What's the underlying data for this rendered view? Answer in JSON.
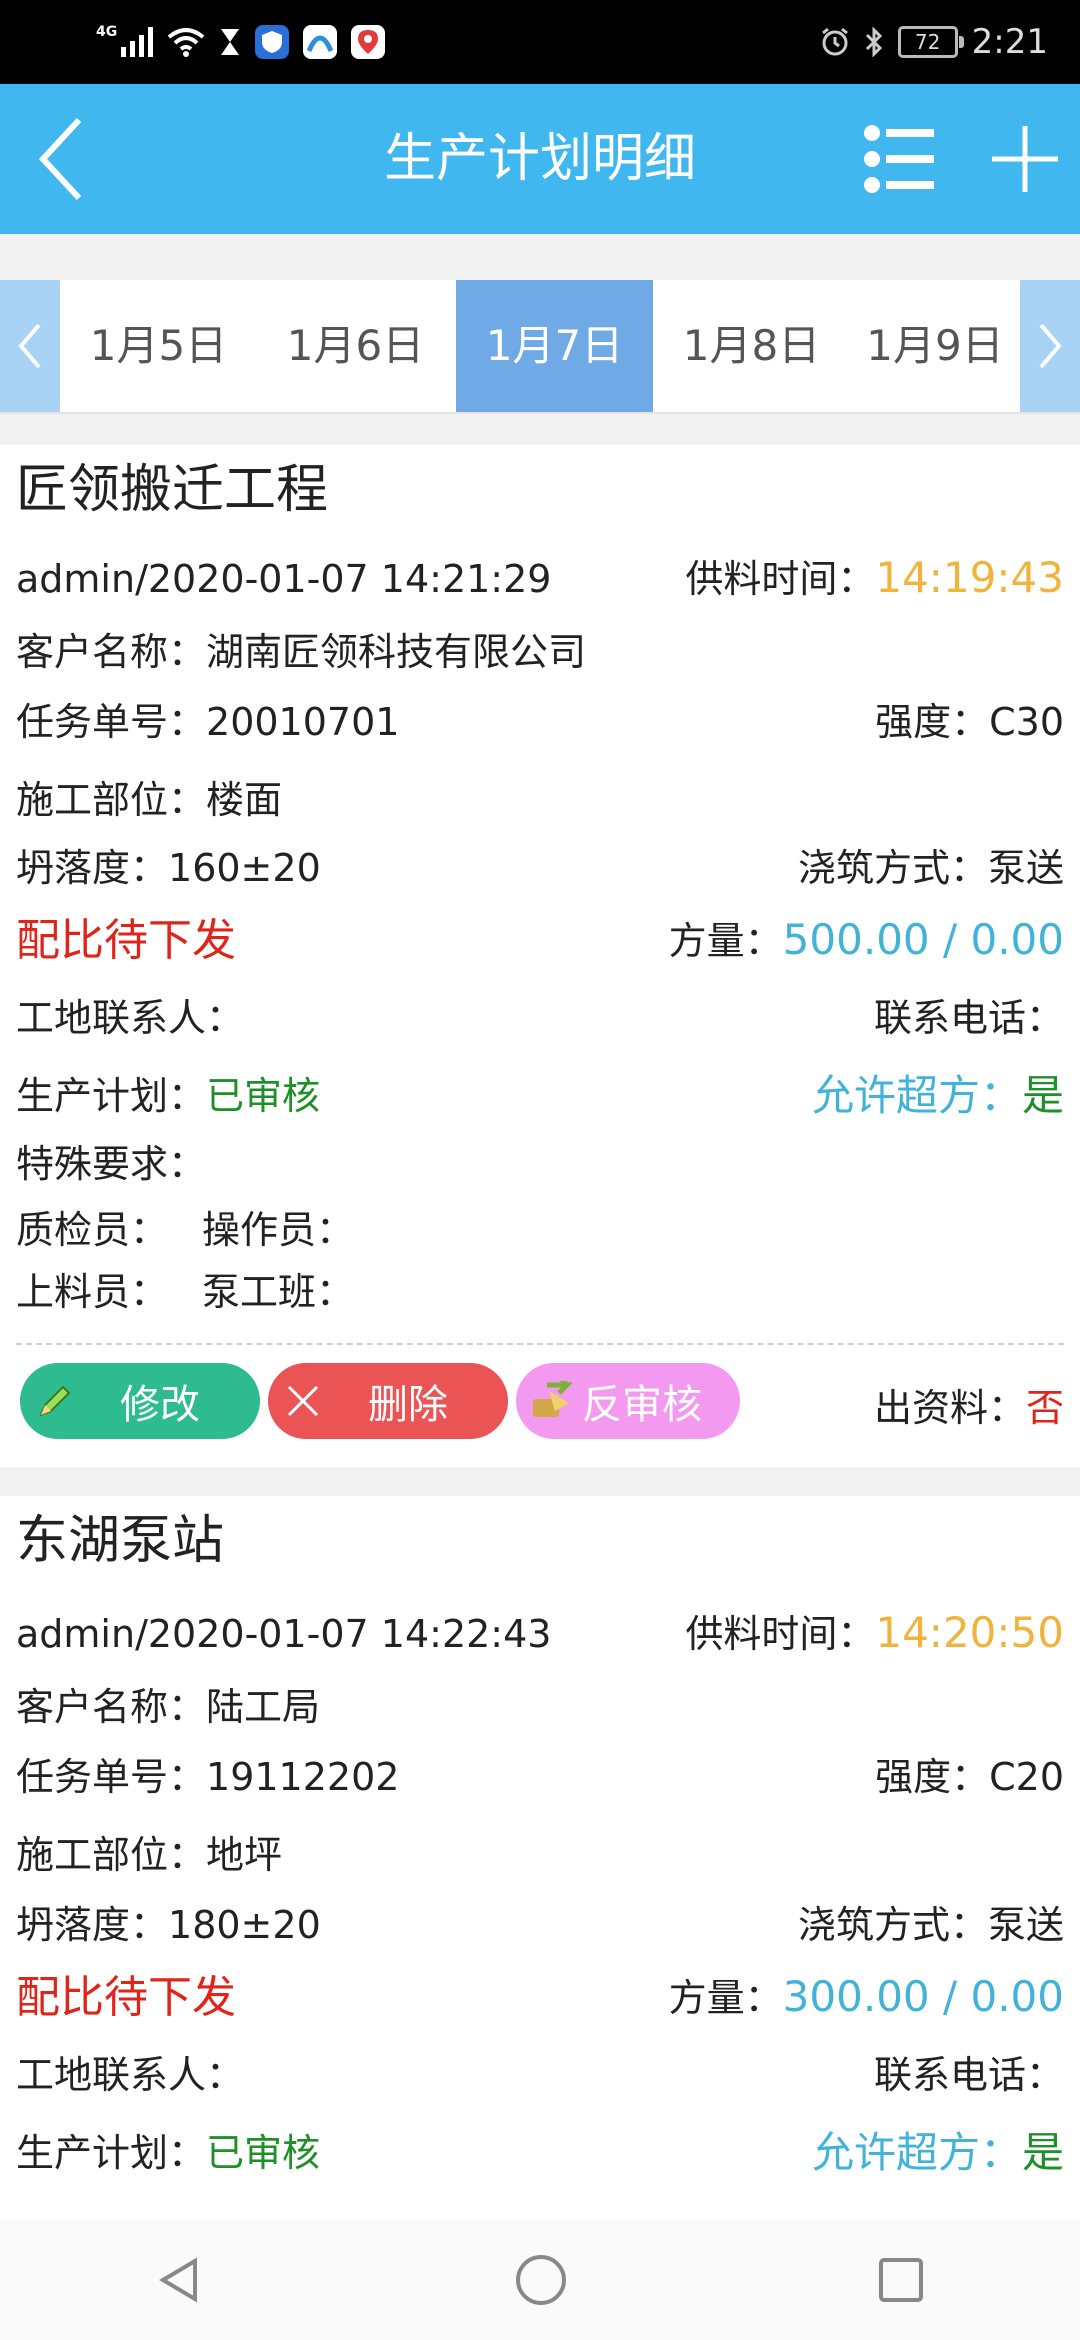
{
  "status_bar": {
    "network": "4G",
    "battery": "72",
    "time": "2:21"
  },
  "header": {
    "title": "生产计划明细"
  },
  "date_tabs": [
    "1月5日",
    "1月6日",
    "1月7日",
    "1月8日",
    "1月9日"
  ],
  "active_date_index": 2,
  "cards": [
    {
      "project": "匠领搬迁工程",
      "creator_time": "admin/2020-01-07 14:21:29",
      "supply_time_label": "供料时间：",
      "supply_time": "14:19:43",
      "customer_label": "客户名称：",
      "customer": "湖南匠领科技有限公司",
      "task_no_label": "任务单号：",
      "task_no": "20010701",
      "strength_label": "强度：",
      "strength": "C30",
      "site_part_label": "施工部位：",
      "site_part": "楼面",
      "slump_label": "坍落度：",
      "slump": "160±20",
      "pour_label": "浇筑方式：",
      "pour": "泵送",
      "mix_status": "配比待下发",
      "volume_label": "方量：",
      "volume": "500.00 / 0.00",
      "site_contact_label": "工地联系人：",
      "phone_label": "联系电话：",
      "plan_label": "生产计划：",
      "plan_status": "已审核",
      "overfill_label": "允许超方：",
      "overfill": "是",
      "special_label": "特殊要求：",
      "special": "",
      "inspector_label": "质检员：",
      "operator_label": "操作员：",
      "loader_label": "上料员：",
      "pump_label": "泵工班：",
      "btn_edit": "修改",
      "btn_delete": "删除",
      "btn_unapprove": "反审核",
      "material_label": "出资料：",
      "material": "否"
    },
    {
      "project": "东湖泵站",
      "creator_time": "admin/2020-01-07 14:22:43",
      "supply_time_label": "供料时间：",
      "supply_time": "14:20:50",
      "customer_label": "客户名称：",
      "customer": "陆工局",
      "task_no_label": "任务单号：",
      "task_no": "19112202",
      "strength_label": "强度：",
      "strength": "C20",
      "site_part_label": "施工部位：",
      "site_part": "地坪",
      "slump_label": "坍落度：",
      "slump": "180±20",
      "pour_label": "浇筑方式：",
      "pour": "泵送",
      "mix_status": "配比待下发",
      "volume_label": "方量：",
      "volume": "300.00 / 0.00",
      "site_contact_label": "工地联系人：",
      "phone_label": "联系电话：",
      "plan_label": "生产计划：",
      "plan_status": "已审核",
      "overfill_label": "允许超方：",
      "overfill": "是"
    }
  ],
  "colors": {
    "header": "#41b7ef",
    "active_tab": "#6fa9e6",
    "supply_time": "#f0b43c",
    "volume": "#41b3d9",
    "alert": "#e0241a",
    "ok": "#1f8f2a",
    "btn_edit": "#2dbb8f",
    "btn_delete": "#ea5454",
    "btn_unapprove": "#f39af0"
  }
}
